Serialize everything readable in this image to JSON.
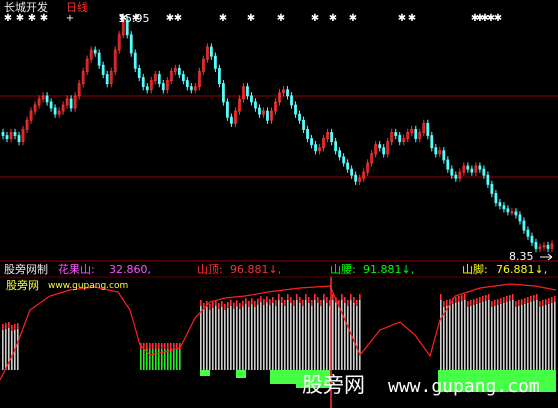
{
  "header": {
    "title": "长城开发",
    "period": "日线"
  },
  "price_labels": {
    "high": "15.95",
    "low": "8.35"
  },
  "indicator": {
    "name": "股旁网制",
    "items": [
      {
        "label": "花果山:",
        "value": "32.860,",
        "color": "#ff55ff"
      },
      {
        "label": "山顶:",
        "value": "96.881↓,",
        "color": "#ff3030"
      },
      {
        "label": "山腰:",
        "value": "91.881↓,",
        "color": "#00ff00"
      },
      {
        "label": "山脚:",
        "value": "76.881↓,",
        "color": "#ffff00"
      }
    ]
  },
  "site": {
    "name": "股旁网",
    "url": "www.gupang.com"
  },
  "watermark": {
    "cn": "股旁网",
    "url": "www.gupang.com"
  },
  "colors": {
    "up": "#ff3232",
    "down": "#54ffff",
    "grid": "#a00000",
    "white": "#ffffff",
    "red_line": "#ff2020",
    "green": "#22ee22",
    "bright_green": "#44ff44"
  },
  "chart_data": {
    "type": "candlestick",
    "price_range": [
      8.35,
      15.95
    ],
    "close": [
      12.1,
      12.0,
      12.2,
      12.1,
      11.9,
      12.3,
      12.6,
      12.9,
      13.1,
      13.3,
      13.4,
      13.2,
      13.0,
      12.8,
      12.9,
      13.1,
      13.3,
      13.0,
      13.4,
      13.8,
      14.2,
      14.6,
      14.9,
      14.8,
      14.4,
      14.1,
      13.8,
      14.2,
      14.9,
      15.4,
      15.9,
      15.4,
      14.8,
      14.3,
      14.0,
      13.7,
      13.6,
      13.9,
      14.1,
      13.8,
      13.6,
      13.9,
      14.2,
      14.3,
      14.1,
      13.9,
      13.7,
      13.6,
      13.7,
      14.2,
      14.6,
      15.0,
      14.7,
      14.3,
      13.8,
      13.2,
      12.7,
      12.5,
      12.9,
      13.3,
      13.7,
      13.4,
      13.2,
      13.0,
      12.8,
      12.9,
      12.6,
      12.9,
      13.2,
      13.5,
      13.6,
      13.4,
      13.1,
      12.8,
      12.6,
      12.3,
      12.0,
      11.8,
      11.6,
      11.7,
      12.0,
      12.2,
      11.9,
      11.6,
      11.4,
      11.2,
      11.0,
      10.8,
      10.6,
      10.7,
      10.9,
      11.2,
      11.5,
      11.8,
      11.7,
      11.5,
      11.9,
      12.2,
      12.1,
      11.9,
      12.0,
      12.2,
      12.3,
      12.0,
      12.2,
      12.5,
      12.1,
      11.7,
      11.5,
      11.6,
      11.3,
      11.0,
      10.8,
      10.7,
      10.9,
      11.1,
      11.0,
      10.9,
      11.1,
      11.0,
      10.8,
      10.5,
      10.2,
      9.9,
      9.8,
      9.7,
      9.6,
      9.6,
      9.5,
      9.3,
      9.0,
      8.8,
      8.6,
      8.4,
      8.45,
      8.5,
      8.4,
      8.55
    ],
    "mountain_top": [
      96.881
    ],
    "mountain_mid": [
      91.881
    ],
    "mountain_foot": [
      76.881
    ],
    "huaguoshan": [
      32.86
    ]
  }
}
